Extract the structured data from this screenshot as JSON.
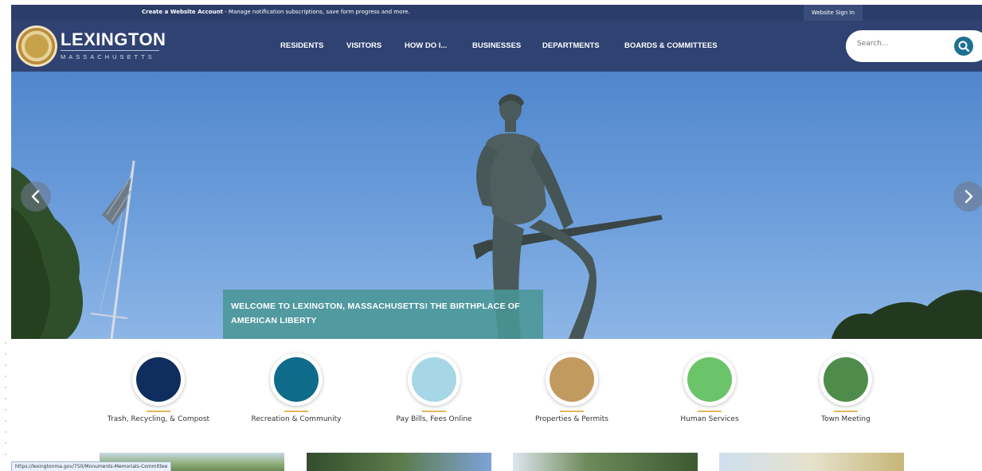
{
  "topbar": {
    "account_link_bold": "Create a Website Account",
    "account_link_rest": " - Manage notification subscriptions, save form progress and more.",
    "signin_label": "Website Sign In"
  },
  "header": {
    "brand_name": "LEXINGTON",
    "brand_sub": "MASSACHUSETTS",
    "seal_icon": "town-seal-icon"
  },
  "nav": {
    "items": [
      {
        "label": "RESIDENTS"
      },
      {
        "label": "VISITORS"
      },
      {
        "label": "HOW DO I..."
      },
      {
        "label": "BUSINESSES"
      },
      {
        "label": "DEPARTMENTS"
      },
      {
        "label": "BOARDS & COMMITTEES"
      }
    ]
  },
  "search": {
    "placeholder": "Search...",
    "icon": "search-icon"
  },
  "hero": {
    "caption": "WELCOME TO LEXINGTON, MASSACHUSETTS! THE BIRTHPLACE OF AMERICAN LIBERTY",
    "prev_icon": "chevron-left-icon",
    "next_icon": "chevron-right-icon"
  },
  "quick_links": [
    {
      "label": "Trash, Recycling, & Compost",
      "color": "#0f2d5e"
    },
    {
      "label": "Recreation & Community",
      "color": "#0f6b8a"
    },
    {
      "label": "Pay Bills, Fees Online",
      "color": "#a7d7e6"
    },
    {
      "label": "Properties & Permits",
      "color": "#c19a60"
    },
    {
      "label": "Human Services",
      "color": "#6cc46a"
    },
    {
      "label": "Town Meeting",
      "color": "#4f8c4c"
    }
  ],
  "status_bar": {
    "url": "https://lexingtonma.gov/750/Monuments-Memorials-Committee"
  },
  "colors": {
    "header_bg": "#2f4272",
    "topbar_bg": "#2b3e6b",
    "accent_gold": "#e2b65a",
    "caption_bg": "#4a9696"
  }
}
